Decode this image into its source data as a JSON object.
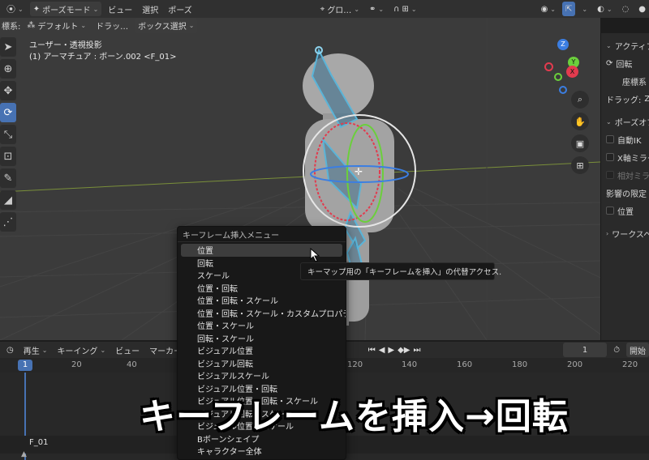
{
  "header": {
    "mode_label": "ポーズモード",
    "menus": [
      "ビュー",
      "選択",
      "ポーズ"
    ],
    "transform_orientation": "グロ…"
  },
  "subheader": {
    "coord_label": "標系:",
    "pivot_value": "デフォルト",
    "drag_label": "ドラッ…",
    "select_mode": "ボックス選択"
  },
  "viewport": {
    "view_name": "ユーザー・透視投影",
    "object_info": "(1) アーマチュア : ボーン.002 <F_01>"
  },
  "gizmo": {
    "z": "Z",
    "y": "Y",
    "x": "X"
  },
  "npanel": {
    "section_active": "アクティブ",
    "rotate_label": "回転",
    "coord_sys": "座標系",
    "drag": "ドラッグ:",
    "drag_value": "Z",
    "pose_options": "ポーズオプ",
    "auto_ik": "自動IK",
    "x_mirror": "X軸ミラー",
    "rel_mirror": "相対ミラー",
    "affect_limit": "影響の限定",
    "location": "位置",
    "workspace": "ワークスペー"
  },
  "timeline": {
    "menus": [
      "再生",
      "キーイング",
      "ビュー",
      "マーカー"
    ],
    "current_frame": "1",
    "start_label": "開始",
    "ruler_ticks": [
      "1",
      "20",
      "40",
      "120",
      "140",
      "160",
      "180",
      "200",
      "220"
    ],
    "channel_name": "F_01"
  },
  "menu": {
    "title": "キーフレーム挿入メニュー",
    "items": [
      "位置",
      "回転",
      "スケール",
      "位置・回転",
      "位置・回転・スケール",
      "位置・回転・スケール・カスタムプロパティ",
      "位置・スケール",
      "回転・スケール",
      "ビジュアル位置",
      "ビジュアル回転",
      "ビジュアルスケール",
      "ビジュアル位置・回転",
      "ビジュアル位置・回転・スケール",
      "ビジュアル回転・スケール",
      "ビジュアル位置・スケール",
      "Bボーンシェイプ",
      "キャラクター全体"
    ]
  },
  "tooltip": "キーマップ用の「キーフレームを挿入」の代替アクセス.",
  "caption": "キーフレームを挿入→回転",
  "colors": {
    "accent": "#4772b3",
    "bone": "#5ab4d8",
    "ring_white": "#e6e6e6",
    "x_axis": "#e23b4e",
    "y_axis": "#6bcf3c",
    "z_axis": "#3b7ee2"
  }
}
